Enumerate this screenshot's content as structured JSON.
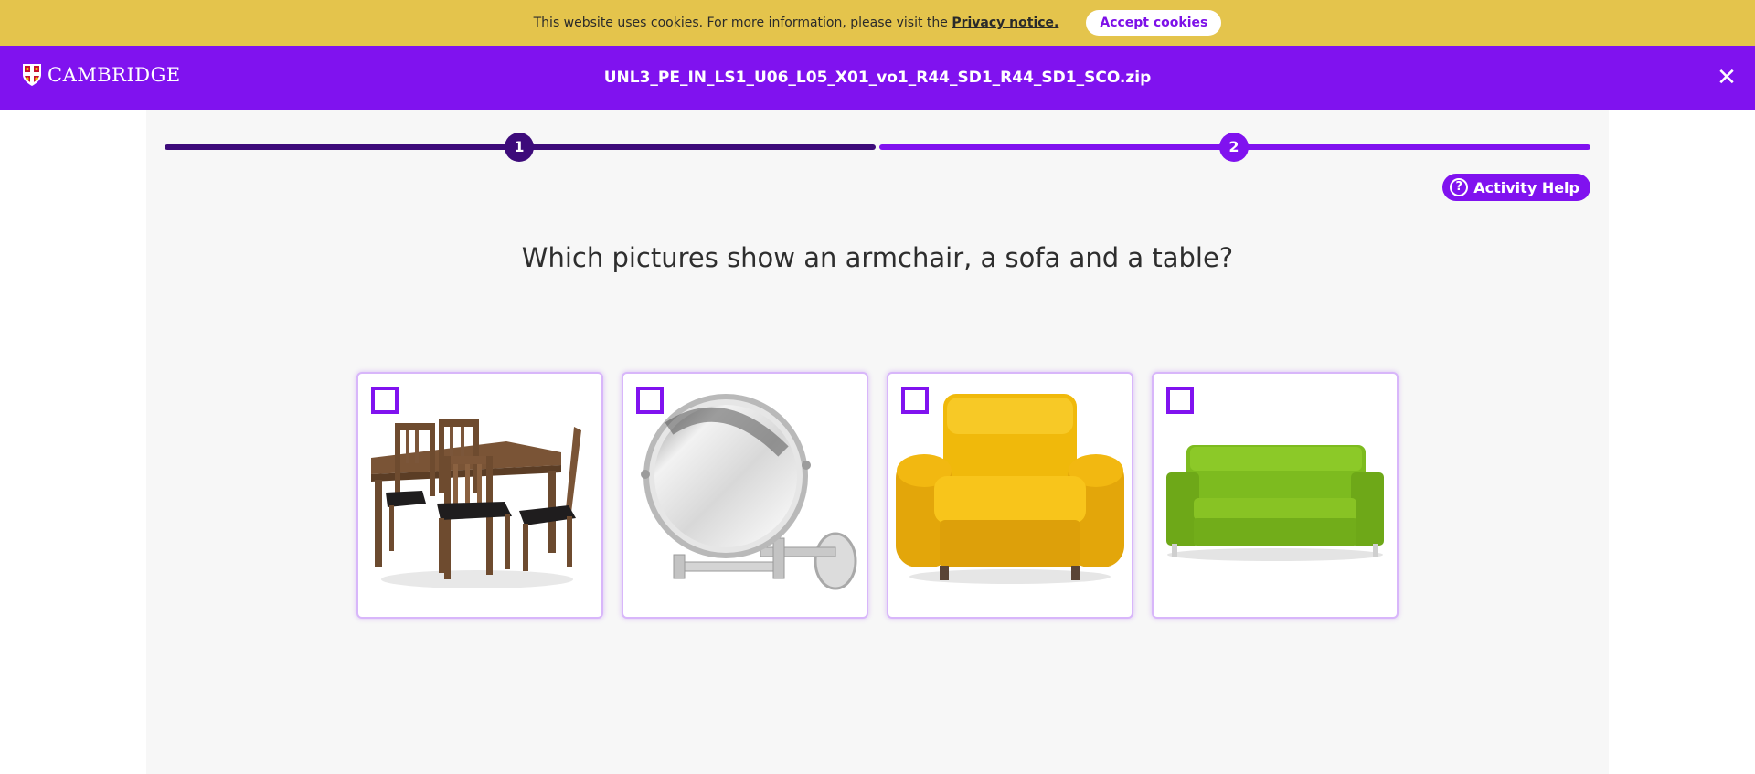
{
  "cookie": {
    "text": "This website uses cookies. For more information, please visit the ",
    "link": "Privacy notice.",
    "button": "Accept cookies"
  },
  "header": {
    "logo": "CAMBRIDGE",
    "title": "UNL3_PE_IN_LS1_U06_L05_X01_vo1_R44_SD1_R44_SD1_SCO.zip",
    "close_icon": "close-icon"
  },
  "progress": {
    "steps": [
      "1",
      "2"
    ],
    "current_step": 2
  },
  "help": {
    "label": "Activity Help",
    "icon": "?"
  },
  "question": "Which pictures show an armchair, a sofa and a table?",
  "options": [
    {
      "name": "table-and-chairs",
      "checked": false
    },
    {
      "name": "mirror",
      "checked": false
    },
    {
      "name": "armchair",
      "checked": false
    },
    {
      "name": "sofa",
      "checked": false
    }
  ],
  "colors": {
    "cookie_bar": "#e4c44c",
    "brand_purple": "#8012ef",
    "dark_purple": "#3d0b7a"
  }
}
